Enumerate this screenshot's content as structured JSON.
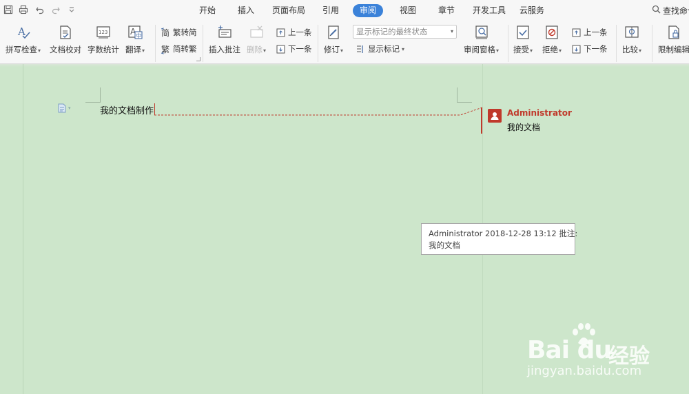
{
  "tabs": [
    {
      "label": "开始",
      "active": false
    },
    {
      "label": "插入",
      "active": false
    },
    {
      "label": "页面布局",
      "active": false
    },
    {
      "label": "引用",
      "active": false
    },
    {
      "label": "审阅",
      "active": true
    },
    {
      "label": "视图",
      "active": false
    },
    {
      "label": "章节",
      "active": false
    },
    {
      "label": "开发工具",
      "active": false
    },
    {
      "label": "云服务",
      "active": false
    }
  ],
  "search": {
    "label": "查找命令"
  },
  "ribbon": {
    "spell_check": "拼写检查",
    "doc_proof": "文档校对",
    "word_count": "字数统计",
    "translate": "翻译",
    "trad_to_simp": "繁转简",
    "simp_to_trad": "简转繁",
    "insert_comment": "插入批注",
    "delete": "删除",
    "prev_comment": "上一条",
    "next_comment": "下一条",
    "track_changes": "修订",
    "markup_state": "显示标记的最终状态",
    "show_markup": "显示标记",
    "review_pane": "审阅窗格",
    "accept": "接受",
    "reject": "拒绝",
    "prev_change": "上一条",
    "next_change": "下一条",
    "compare": "比较",
    "restrict_edit": "限制编辑"
  },
  "document": {
    "text": "我的文档制作"
  },
  "comment": {
    "author": "Administrator",
    "text": "我的文档"
  },
  "tooltip": {
    "header": "Administrator 2018-12-28 13:12 批注:",
    "text": "我的文档"
  },
  "watermark": {
    "logo_text": "Bai  du",
    "cn_text": "经验",
    "url": "jingyan.baidu.com"
  },
  "colors": {
    "accent": "#3b82d9",
    "comment": "#c0392b",
    "canvas": "#cde6cb"
  }
}
